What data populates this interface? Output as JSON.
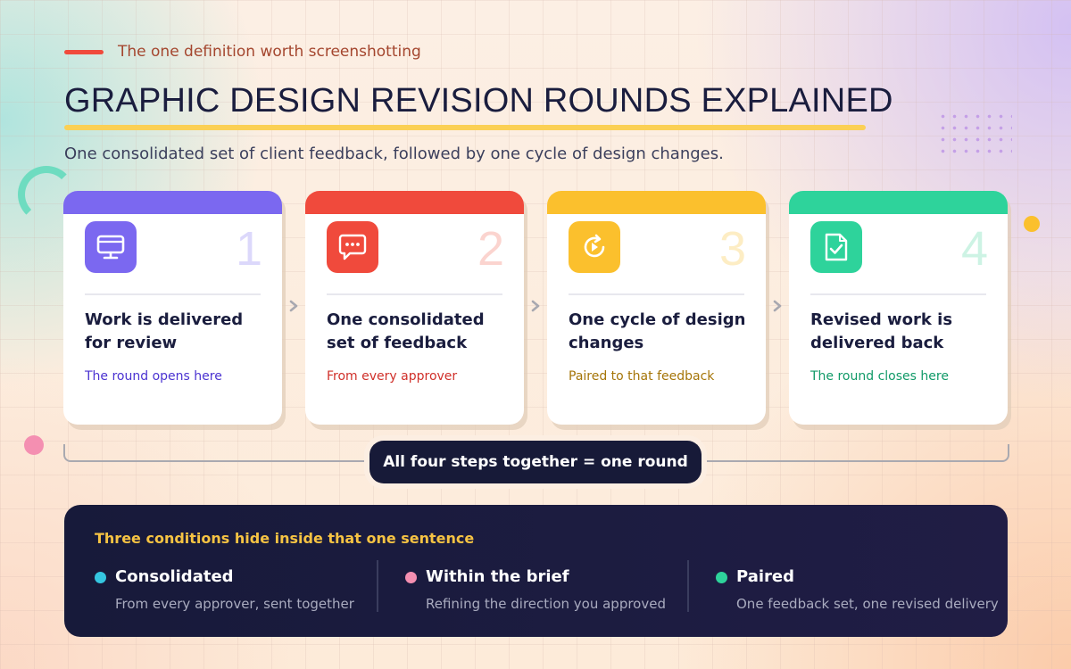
{
  "eyebrow": "The one definition worth screenshotting",
  "title": "GRAPHIC DESIGN REVISION ROUNDS EXPLAINED",
  "subtitle": "One consolidated set of client feedback, followed by one cycle of design changes.",
  "colors": {
    "purple": "#7b68f0",
    "red": "#f04a3c",
    "yellow": "#fbc02d",
    "green": "#2ed39b",
    "navy": "#171a38",
    "gold": "#f6c343"
  },
  "steps": [
    {
      "number": "1",
      "title": "Work is delivered for review",
      "subtitle": "The round opens here",
      "icon": "monitor-icon"
    },
    {
      "number": "2",
      "title": "One consolidated set of feedback",
      "subtitle": "From every approver",
      "icon": "chat-bubble-icon"
    },
    {
      "number": "3",
      "title": "One cycle of design changes",
      "subtitle": "Paired to that feedback",
      "icon": "refresh-cycle-icon"
    },
    {
      "number": "4",
      "title": "Revised work is delivered back",
      "subtitle": "The round closes here",
      "icon": "checked-document-icon"
    }
  ],
  "summary_pill": "All four steps together = one round",
  "conditions": {
    "heading": "Three conditions hide inside that one sentence",
    "items": [
      {
        "title": "Consolidated",
        "description": "From every approver, sent together"
      },
      {
        "title": "Within the brief",
        "description": "Refining the direction you approved"
      },
      {
        "title": "Paired",
        "description": "One feedback set, one revised delivery"
      }
    ]
  }
}
